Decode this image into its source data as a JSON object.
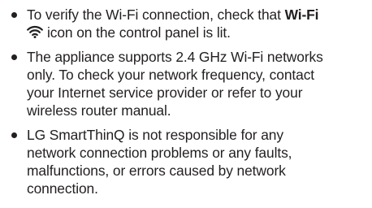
{
  "notes": [
    {
      "line1_text": "To verify the Wi-Fi connection, check that ",
      "line1_bold": "Wi-Fi",
      "icon": "wifi-icon",
      "line2_text": "icon on the control panel is lit."
    },
    {
      "lines": [
        "The appliance supports 2.4 GHz Wi-Fi networks",
        "only. To check your network frequency, contact",
        "your Internet service provider or refer to your",
        "wireless router manual."
      ]
    },
    {
      "lines": [
        "LG SmartThinQ is not responsible for any",
        "network connection problems or any faults,",
        "malfunctions, or errors caused by network",
        "connection."
      ]
    }
  ]
}
